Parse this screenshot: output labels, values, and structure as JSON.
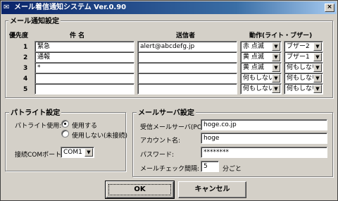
{
  "window": {
    "title": "メール着信通知システム Ver.0.90"
  },
  "notify": {
    "group_label": "メール通知設定",
    "headers": {
      "priority": "優先度",
      "subject": "件 名",
      "sender": "送信者",
      "action": "動作(ライト・ブザー)"
    },
    "rows": [
      {
        "num": "1",
        "subject": "緊急",
        "sender": "alert@abcdefg.jp",
        "light": "赤 点滅",
        "buzzer": "ブザー2"
      },
      {
        "num": "2",
        "subject": "通報",
        "sender": "",
        "light": "黄 点滅",
        "buzzer": "ブザー1"
      },
      {
        "num": "3",
        "subject": "*",
        "sender": "",
        "light": "黄 点滅",
        "buzzer": "何もしない"
      },
      {
        "num": "4",
        "subject": "",
        "sender": "",
        "light": "何もしない",
        "buzzer": "何もしない"
      },
      {
        "num": "5",
        "subject": "",
        "sender": "",
        "light": "何もしない",
        "buzzer": "何もしない"
      }
    ]
  },
  "patlite": {
    "group_label": "パトライト設定",
    "use_label": "パトライト使用:",
    "opt_use": "使用する",
    "opt_nouse": "使用しない(未接続)",
    "selected": "use",
    "port_label": "接続COMポート:",
    "port_value": "COM1"
  },
  "server": {
    "group_label": "メールサーバ設定",
    "pop3_label": "受信メールサーバ(POP3):",
    "pop3_value": "hoge.co.jp",
    "account_label": "アカウント名:",
    "account_value": "hoge",
    "password_label": "パスワード:",
    "password_value": "********",
    "interval_label": "メールチェック間隔:",
    "interval_value": "5",
    "interval_unit": "分ごと"
  },
  "buttons": {
    "ok": "OK",
    "cancel": "キャンセル"
  }
}
